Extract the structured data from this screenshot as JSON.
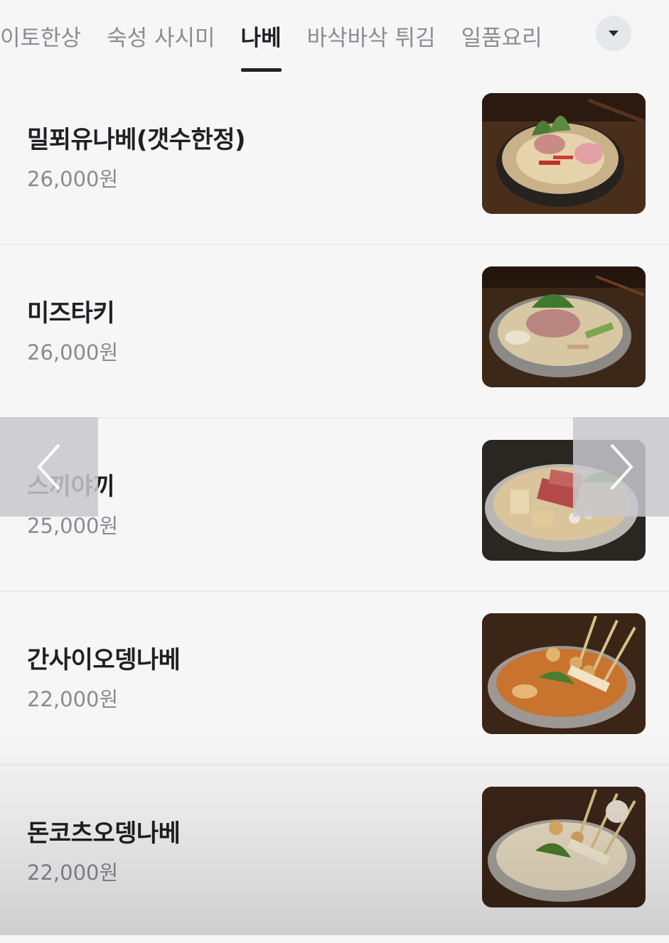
{
  "category_tabs": [
    {
      "label": "이토한상"
    },
    {
      "label": "숙성 사시미"
    },
    {
      "label": "나베"
    },
    {
      "label": "바삭바삭 튀김"
    },
    {
      "label": "일품요리"
    }
  ],
  "active_tab": "나베",
  "more_icon": "chevron-down-icon",
  "menu_items": [
    {
      "name": "밀푀유나베(갯수한정)",
      "price": "26,000원",
      "image": "millefeuille-nabe-photo"
    },
    {
      "name": "미즈타키",
      "price": "26,000원",
      "image": "mizutaki-photo"
    },
    {
      "name": "스끼야끼",
      "price": "25,000원",
      "image": "sukiyaki-photo"
    },
    {
      "name": "간사이오뎅나베",
      "price": "22,000원",
      "image": "kansai-oden-nabe-photo"
    },
    {
      "name": "돈코츠오뎅나베",
      "price": "22,000원",
      "image": "tonkotsu-oden-nabe-photo"
    }
  ],
  "gallery_nav": {
    "prev_icon": "chevron-left-icon",
    "next_icon": "chevron-right-icon"
  },
  "colors": {
    "background": "#f6f6f7",
    "text_primary": "#202024",
    "text_secondary": "#8b8b90",
    "active_underline": "#222225"
  }
}
